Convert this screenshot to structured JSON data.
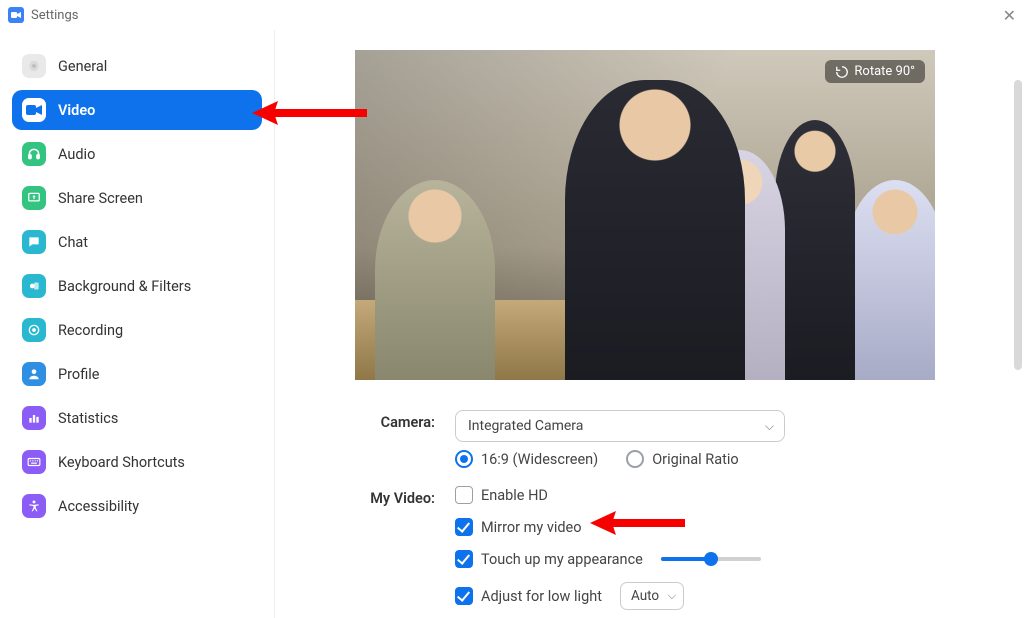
{
  "window": {
    "title": "Settings",
    "close_glyph": "✕"
  },
  "sidebar": {
    "items": [
      {
        "label": "General",
        "icon": "gear-icon",
        "color": "#d8d8d8"
      },
      {
        "label": "Video",
        "icon": "video-icon",
        "color": "#ffffff",
        "active": true
      },
      {
        "label": "Audio",
        "icon": "headphones-icon",
        "color": "#33c481"
      },
      {
        "label": "Share Screen",
        "icon": "share-icon",
        "color": "#33c481"
      },
      {
        "label": "Chat",
        "icon": "chat-icon",
        "color": "#2ab8d1"
      },
      {
        "label": "Background & Filters",
        "icon": "filters-icon",
        "color": "#2ab8d1"
      },
      {
        "label": "Recording",
        "icon": "record-icon",
        "color": "#2ab8d1"
      },
      {
        "label": "Profile",
        "icon": "person-icon",
        "color": "#2f8fe3"
      },
      {
        "label": "Statistics",
        "icon": "stats-icon",
        "color": "#8b5cf6"
      },
      {
        "label": "Keyboard Shortcuts",
        "icon": "keyboard-icon",
        "color": "#8b5cf6"
      },
      {
        "label": "Accessibility",
        "icon": "accessibility-icon",
        "color": "#8b5cf6"
      }
    ]
  },
  "preview": {
    "rotate_label": "Rotate 90°"
  },
  "camera": {
    "label": "Camera:",
    "selected": "Integrated Camera",
    "aspect": {
      "widescreen": "16:9 (Widescreen)",
      "original": "Original Ratio",
      "value": "widescreen"
    }
  },
  "my_video": {
    "label": "My Video:",
    "enable_hd": {
      "label": "Enable HD",
      "checked": false
    },
    "mirror": {
      "label": "Mirror my video",
      "checked": true
    },
    "touch_up": {
      "label": "Touch up my appearance",
      "checked": true,
      "slider": 50
    },
    "low_light": {
      "label": "Adjust for low light",
      "checked": true,
      "mode": "Auto"
    }
  },
  "colors": {
    "accent": "#0e72ed",
    "arrow": "#f70000"
  }
}
